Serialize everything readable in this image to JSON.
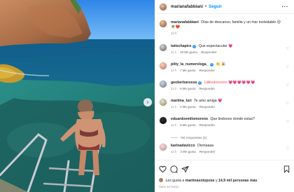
{
  "post": {
    "author": "marianafabbiani",
    "follow_label": "Seguir",
    "more_label": "···",
    "next_label": "›"
  },
  "caption": {
    "username": "marianafabbiani",
    "text": "Días de descanso, familia y un mar inolvidable 😍🌴❤️",
    "time": "12 h"
  },
  "comments": [
    {
      "username": "tatischapiro",
      "verified": true,
      "text": "Que espectacular 💗",
      "time": "11 h",
      "likes": "30 Me gusta",
      "reply": "Responder"
    },
    {
      "username": "pitty_la_numerologa_",
      "verified": true,
      "text": "👏 🎉",
      "time": "11 h",
      "likes": "7 Me gusta",
      "reply": "Responder"
    },
    {
      "username": "geoberbarossa",
      "verified": true,
      "text": "Liiiiiindoooooo 💗💗💗💗💗💗",
      "time": "11 h",
      "likes": "6 Me gusta",
      "reply": "Responder"
    },
    {
      "username": "martina_luri",
      "verified": false,
      "text": "Te amo amiga 💗",
      "time": "11 h",
      "likes": "2 Me gusta",
      "reply": "Responder"
    },
    {
      "username": "eduardoemilomoreno",
      "verified": false,
      "text": "Que lindoooo donde estas?",
      "time": "11 h",
      "likes": "6 Me gusta",
      "reply": "Responder",
      "replies_label": "Ver respuestas (1)"
    },
    {
      "username": "karinadavicco",
      "verified": false,
      "text": "Divinaaaa",
      "time": "12 h",
      "likes": "2 Me gusta",
      "reply": "Responder"
    }
  ],
  "footer": {
    "liked_prefix": "Les gusta a",
    "liked_user": "martinasotopose",
    "liked_middle": "y",
    "liked_count": "14,9 mil personas más",
    "time": "Hace 12 horas"
  },
  "icons": {
    "heart": "heart-icon",
    "comment": "comment-icon",
    "share": "share-icon",
    "save": "bookmark-icon"
  },
  "colors": {
    "link_blue": "#0095f6",
    "meta_grey": "#8e8e8e",
    "heart_red": "#ed4956",
    "verified_blue": "#3897f0"
  }
}
